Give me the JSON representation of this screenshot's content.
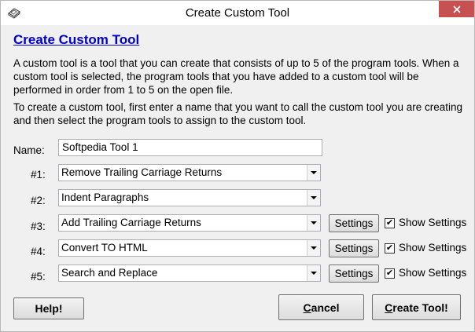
{
  "window": {
    "title": "Create Custom Tool"
  },
  "heading": "Create Custom Tool",
  "paragraphs": [
    "A custom tool is a tool that you can create that consists of up to 5 of the program tools.  When a custom tool is selected, the program tools that you have added to a custom tool will be performed in order from 1 to 5 on the open file.",
    "To create a custom tool, first enter a name that you want to call the custom tool you are creating and then select the program tools to assign to the custom tool."
  ],
  "name_field": {
    "label": "Name:",
    "value": "Softpedia Tool 1"
  },
  "tools": [
    {
      "label": "#1:",
      "selected": "Remove Trailing Carriage Returns",
      "has_settings": false
    },
    {
      "label": "#2:",
      "selected": "Indent Paragraphs",
      "has_settings": false
    },
    {
      "label": "#3:",
      "selected": "Add Trailing Carriage Returns",
      "has_settings": true,
      "settings_label": "Settings",
      "show_settings_label": "Show Settings",
      "show_settings_checked": true
    },
    {
      "label": "#4:",
      "selected": "Convert TO HTML",
      "has_settings": true,
      "settings_label": "Settings",
      "show_settings_label": "Show Settings",
      "show_settings_checked": true
    },
    {
      "label": "#5:",
      "selected": "Search and Replace",
      "has_settings": true,
      "settings_label": "Settings",
      "show_settings_label": "Show Settings",
      "show_settings_checked": true
    }
  ],
  "buttons": {
    "help": "Help!",
    "cancel_prefix": "C",
    "cancel_underlined": "",
    "cancel_rest": "ancel",
    "create_prefix": "",
    "create_underlined": "C",
    "create_rest": "reate Tool!"
  },
  "colors": {
    "heading": "#0000cc",
    "close_button": "#c75050"
  },
  "icons": {
    "app": "keyboard-icon",
    "close": "close-icon",
    "dropdown": "chevron-down-icon",
    "check": "checkmark-icon"
  }
}
